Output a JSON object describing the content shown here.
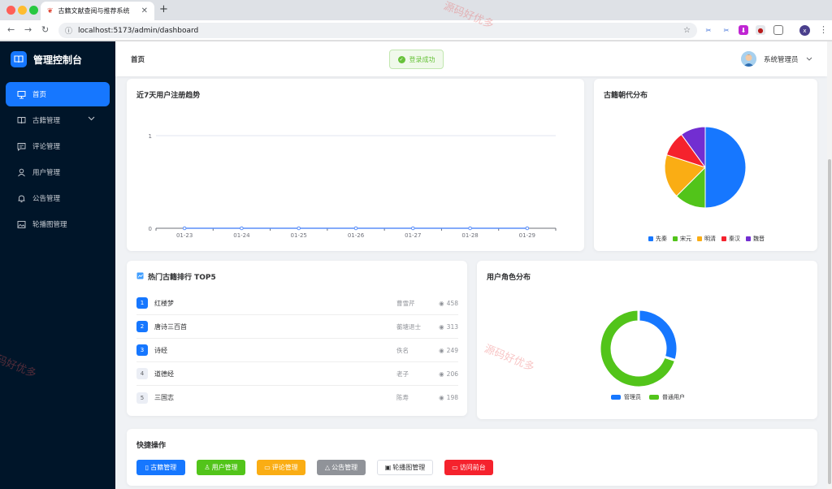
{
  "browser": {
    "tab_title": "古籍文献查阅与推荐系统",
    "url": "localhost:5173/admin/dashboard",
    "profile_initial": "x"
  },
  "sidebar": {
    "title": "管理控制台",
    "items": [
      {
        "label": "首页",
        "icon": "presentation-icon",
        "active": true
      },
      {
        "label": "古籍管理",
        "icon": "book-icon",
        "active": false,
        "expandable": true
      },
      {
        "label": "评论管理",
        "icon": "comment-icon",
        "active": false
      },
      {
        "label": "用户管理",
        "icon": "user-icon",
        "active": false
      },
      {
        "label": "公告管理",
        "icon": "bell-icon",
        "active": false
      },
      {
        "label": "轮播图管理",
        "icon": "image-icon",
        "active": false
      }
    ]
  },
  "header": {
    "breadcrumb": "首页",
    "toast": "登录成功",
    "username": "系统管理员"
  },
  "cards": {
    "trend_title": "近7天用户注册趋势",
    "dynasty_title": "古籍朝代分布",
    "top_title": "热门古籍排行 TOP5",
    "roles_title": "用户角色分布",
    "quick_title": "快捷操作"
  },
  "top_books": [
    {
      "rank": "1",
      "name": "红楼梦",
      "author": "曹雪芹",
      "views": "458"
    },
    {
      "rank": "2",
      "name": "唐诗三百首",
      "author": "蘅塘退士",
      "views": "313"
    },
    {
      "rank": "3",
      "name": "诗经",
      "author": "佚名",
      "views": "249"
    },
    {
      "rank": "4",
      "name": "道德经",
      "author": "老子",
      "views": "206"
    },
    {
      "rank": "5",
      "name": "三国志",
      "author": "陈寿",
      "views": "198"
    }
  ],
  "quick_actions": [
    {
      "label": "古籍管理",
      "icon": "book-icon",
      "color": "#1677ff"
    },
    {
      "label": "用户管理",
      "icon": "user-icon",
      "color": "#52c41a"
    },
    {
      "label": "评论管理",
      "icon": "comment-icon",
      "color": "#faad14"
    },
    {
      "label": "公告管理",
      "icon": "bell-icon",
      "color": "#909399"
    },
    {
      "label": "轮播图管理",
      "icon": "image-icon",
      "color": "#ffffff"
    },
    {
      "label": "访问前台",
      "icon": "monitor-icon",
      "color": "#f5222d"
    }
  ],
  "watermark": "源码好优多",
  "colors": {
    "primary": "#1677ff",
    "sidebar_bg": "#001529",
    "success": "#67c23a"
  },
  "chart_data": [
    {
      "type": "line",
      "x": [
        "01-23",
        "01-24",
        "01-25",
        "01-26",
        "01-27",
        "01-28",
        "01-29"
      ],
      "series": [
        {
          "values": [
            0,
            0,
            0,
            0,
            0,
            0,
            0
          ],
          "color": "#5b8ff9"
        }
      ],
      "yticks": [
        0,
        1
      ],
      "ylim": [
        0,
        1
      ],
      "grid": true
    },
    {
      "type": "pie",
      "slices": [
        {
          "label": "先秦",
          "value": 50,
          "color": "#1677ff"
        },
        {
          "label": "宋元",
          "value": 12.5,
          "color": "#52c41a"
        },
        {
          "label": "明清",
          "value": 17.5,
          "color": "#faad14"
        },
        {
          "label": "秦汉",
          "value": 10,
          "color": "#f5222d"
        },
        {
          "label": "魏晋",
          "value": 10,
          "color": "#722ed1"
        }
      ],
      "legend": "bottom"
    },
    {
      "type": "pie",
      "donut": true,
      "slices": [
        {
          "label": "管理员",
          "value": 30,
          "color": "#1677ff"
        },
        {
          "label": "普通用户",
          "value": 70,
          "color": "#52c41a"
        }
      ],
      "legend": "bottom"
    }
  ]
}
